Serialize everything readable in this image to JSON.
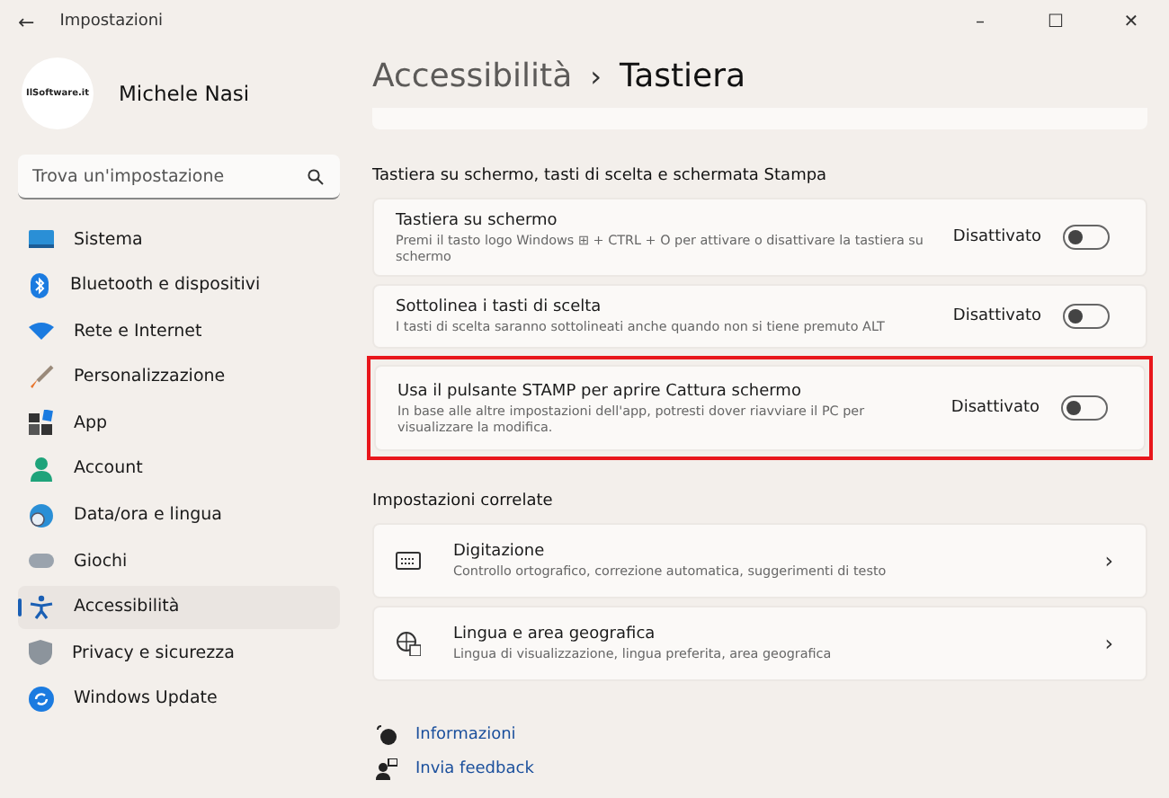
{
  "window": {
    "title": "Impostazioni",
    "back": "←",
    "controls": [
      "–",
      "☐",
      "✕"
    ]
  },
  "profile": {
    "name": "Michele Nasi",
    "logo_text": "IlSoftware.it"
  },
  "search": {
    "placeholder": "Trova un'impostazione"
  },
  "sidebar": {
    "items": [
      {
        "label": "Sistema",
        "selected": false
      },
      {
        "label": "Bluetooth e dispositivi",
        "selected": false
      },
      {
        "label": "Rete e Internet",
        "selected": false
      },
      {
        "label": "Personalizzazione",
        "selected": false
      },
      {
        "label": "App",
        "selected": false
      },
      {
        "label": "Account",
        "selected": false
      },
      {
        "label": "Data/ora e lingua",
        "selected": false
      },
      {
        "label": "Giochi",
        "selected": false
      },
      {
        "label": "Accessibilità",
        "selected": true
      },
      {
        "label": "Privacy e sicurezza",
        "selected": false
      },
      {
        "label": "Windows Update",
        "selected": false
      }
    ]
  },
  "breadcrumb": {
    "parent": "Accessibilità",
    "separator": "›",
    "current": "Tastiera"
  },
  "section": {
    "heading": "Tastiera su schermo, tasti di scelta e schermata Stampa",
    "settings": [
      {
        "title": "Tastiera su schermo",
        "description": "Premi il tasto logo Windows ⊞ + CTRL + O per attivare o disattivare la tastiera su schermo",
        "state_label": "Disattivato",
        "on": false,
        "highlighted": false
      },
      {
        "title": "Sottolinea i tasti di scelta",
        "description": "I tasti di scelta saranno sottolineati anche quando non si tiene premuto ALT",
        "state_label": "Disattivato",
        "on": false,
        "highlighted": false
      },
      {
        "title": "Usa il pulsante STAMP per aprire Cattura schermo",
        "description": "In base alle altre impostazioni dell'app, potresti dover riavviare il PC per visualizzare la modifica.",
        "state_label": "Disattivato",
        "on": false,
        "highlighted": true
      }
    ]
  },
  "related": {
    "heading": "Impostazioni correlate",
    "items": [
      {
        "title": "Digitazione",
        "description": "Controllo ortografico, correzione automatica, suggerimenti di testo",
        "chevron": "›"
      },
      {
        "title": "Lingua e area geografica",
        "description": "Lingua di visualizzazione, lingua preferita, area geografica",
        "chevron": "›"
      }
    ]
  },
  "links": [
    {
      "label": "Informazioni"
    },
    {
      "label": "Invia feedback"
    }
  ]
}
